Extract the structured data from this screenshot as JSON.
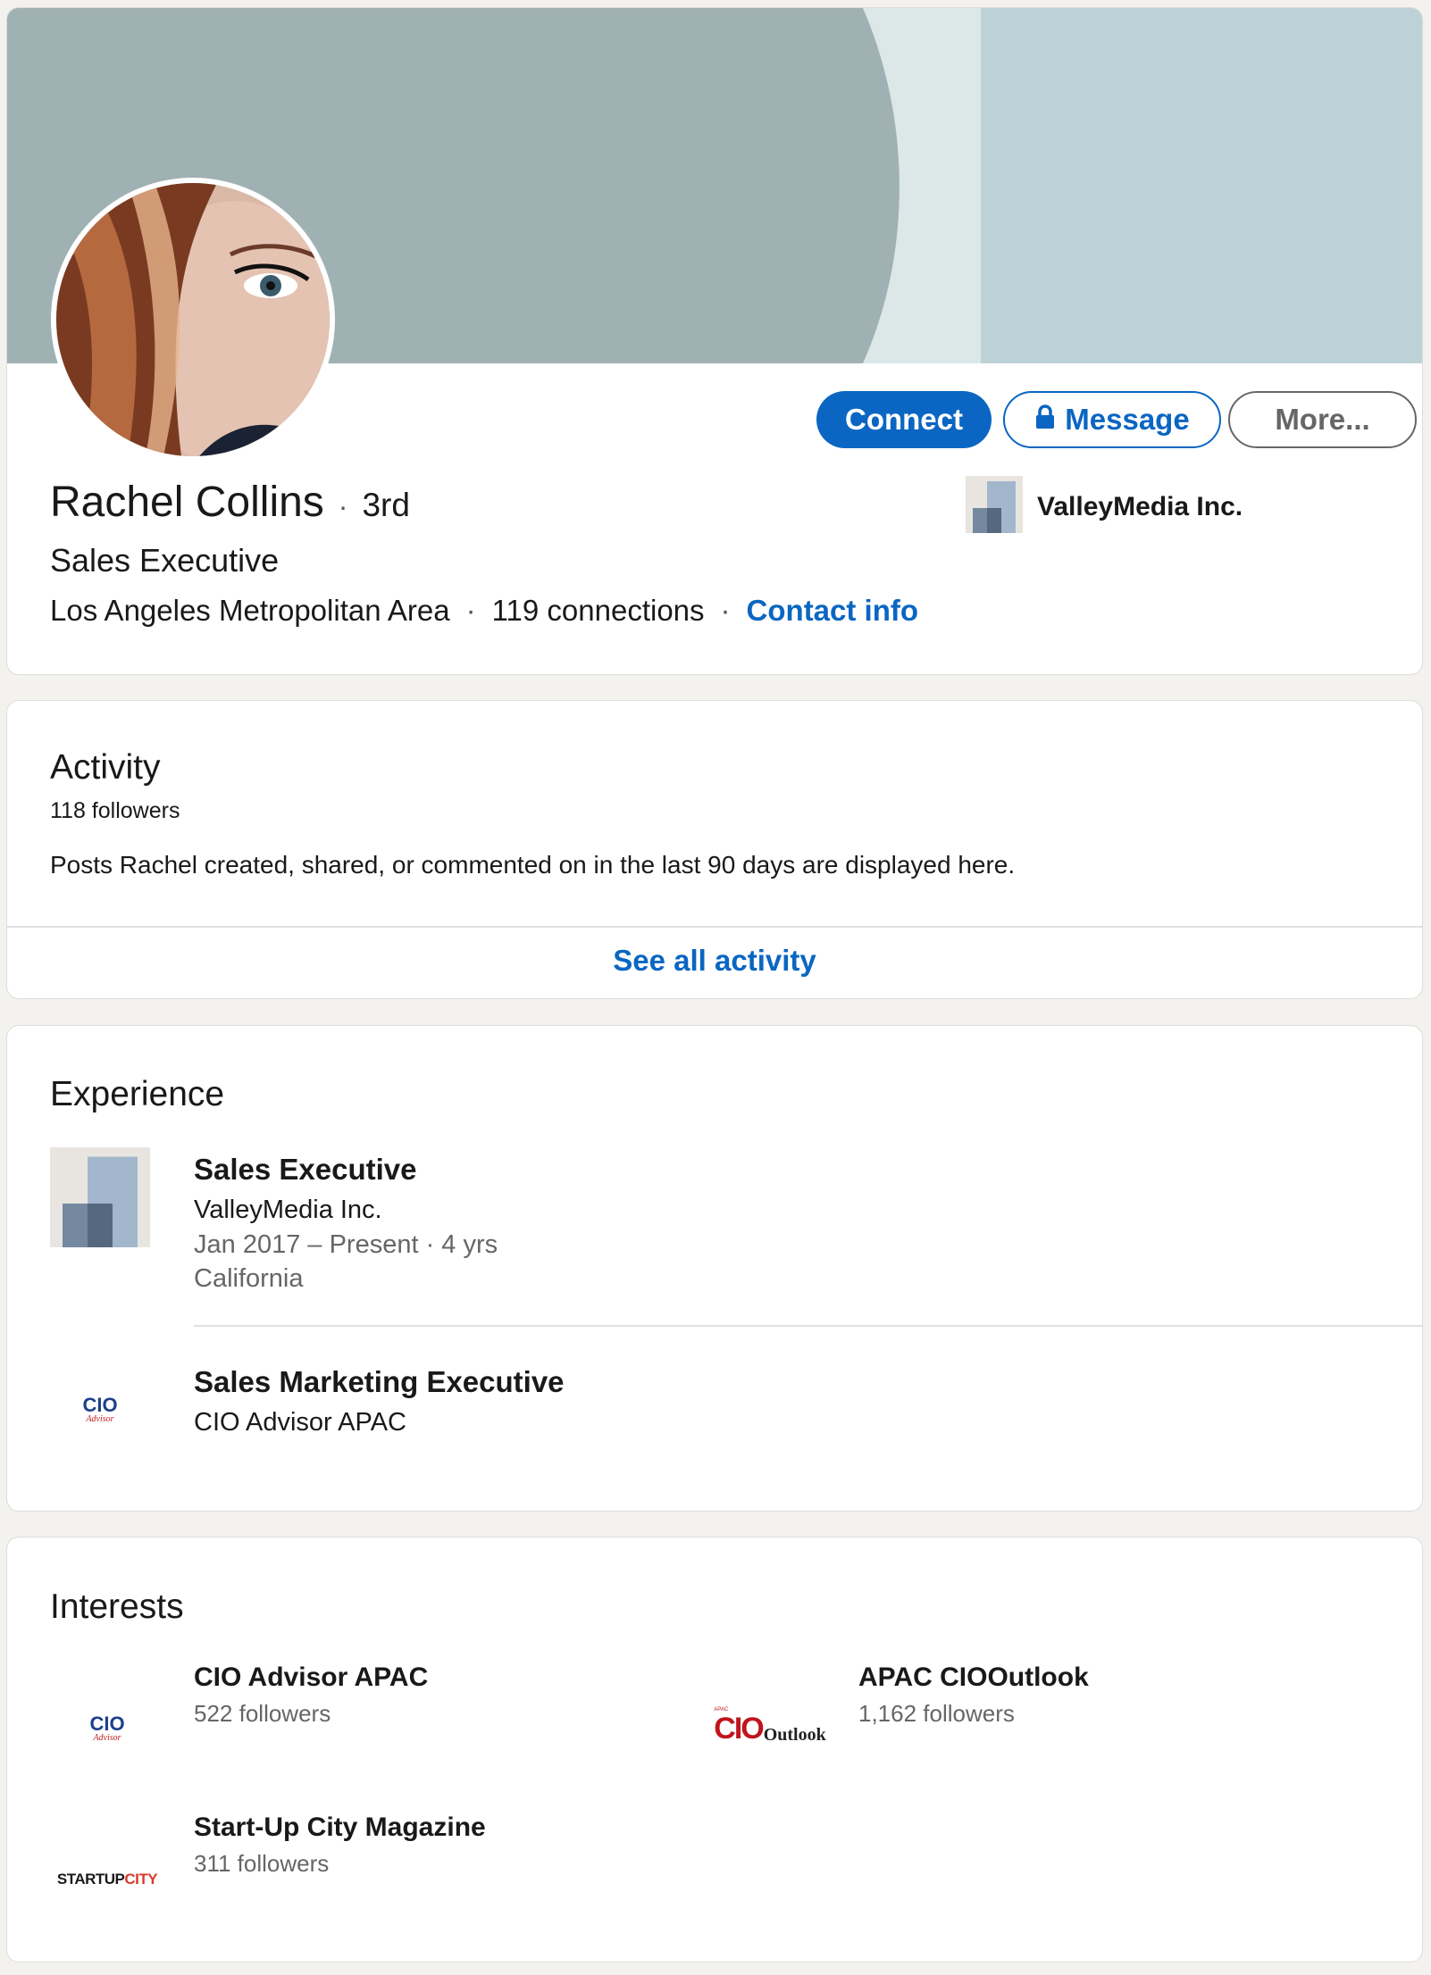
{
  "profile": {
    "name": "Rachel Collins",
    "degree": "3rd",
    "headline": "Sales Executive",
    "location": "Los Angeles Metropolitan Area",
    "connections": "119 connections",
    "contact_info": "Contact info",
    "current_company": "ValleyMedia Inc."
  },
  "actions": {
    "connect": "Connect",
    "message": "Message",
    "more": "More..."
  },
  "activity": {
    "title": "Activity",
    "followers": "118 followers",
    "description": "Posts Rachel created, shared, or commented on in the last 90 days are displayed here.",
    "see_all": "See all activity"
  },
  "experience": {
    "title": "Experience",
    "items": [
      {
        "title": "Sales Executive",
        "company": "ValleyMedia Inc.",
        "dates": "Jan 2017 – Present · 4 yrs",
        "location": "California",
        "logo": "valleymedia-logo"
      },
      {
        "title": "Sales Marketing Executive",
        "company": "CIO Advisor APAC",
        "logo": "cio-advisor-logo"
      }
    ]
  },
  "interests": {
    "title": "Interests",
    "items": [
      {
        "name": "CIO Advisor APAC",
        "followers": "522 followers",
        "logo": "cio-advisor-logo",
        "logo_text": "CIO",
        "logo_sub": "Advisor"
      },
      {
        "name": "APAC CIOOutlook",
        "followers": "1,162 followers",
        "logo": "cio-outlook-logo",
        "logo_text": "CIO",
        "logo_sub": "Outlook",
        "logo_small": "APAC"
      },
      {
        "name": "Start-Up City Magazine",
        "followers": "311 followers",
        "logo": "startup-city-logo",
        "logo_text": "STARTUP",
        "logo_sub": "CITY"
      }
    ]
  },
  "colors": {
    "brand_blue": "#0a66c2",
    "banner_dark": "#a0b1b4",
    "banner_light": "#bdd2d6",
    "page_bg": "#f3f2ef"
  }
}
